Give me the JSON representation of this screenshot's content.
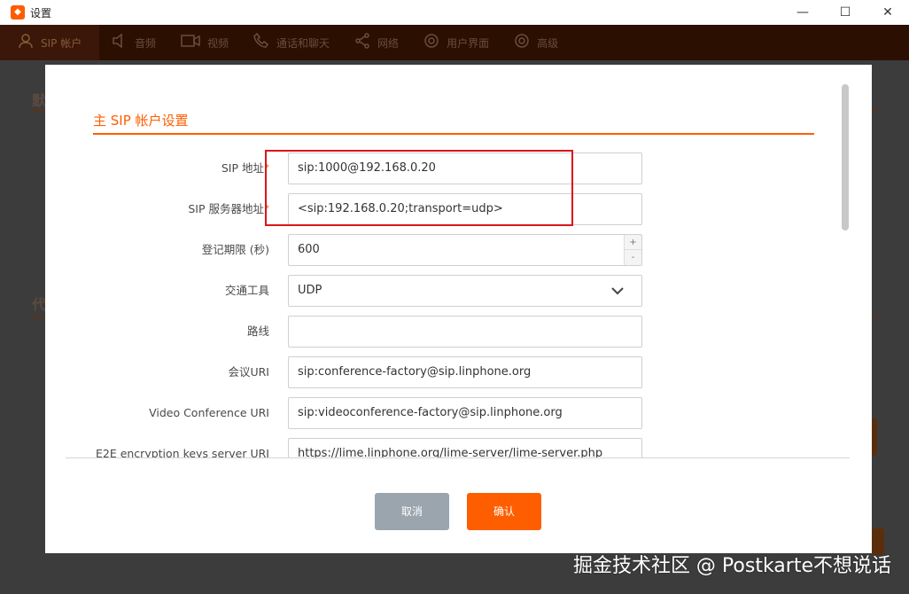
{
  "window": {
    "title": "设置",
    "logo": "linphone-logo-icon",
    "controls": {
      "minimize": "—",
      "maximize": "☐",
      "close": "✕"
    }
  },
  "tabs": [
    {
      "label": "SIP 帐户",
      "icon": "user-icon",
      "active": true
    },
    {
      "label": "音频",
      "icon": "speaker-icon",
      "active": false
    },
    {
      "label": "视频",
      "icon": "camera-icon",
      "active": false
    },
    {
      "label": "通话和聊天",
      "icon": "phone-icon",
      "active": false
    },
    {
      "label": "网络",
      "icon": "share-icon",
      "active": false
    },
    {
      "label": "用户界面",
      "icon": "gear-icon",
      "active": false
    },
    {
      "label": "高级",
      "icon": "gear-icon",
      "active": false
    }
  ],
  "background": {
    "section1": "默",
    "section2": "代"
  },
  "dialog": {
    "section_title": "主 SIP 帐户设置",
    "fields": [
      {
        "label": "SIP 地址",
        "required": "*",
        "value": "sip:1000@192.168.0.20"
      },
      {
        "label": "SIP 服务器地址",
        "required": "*",
        "value": "<sip:192.168.0.20;transport=udp>"
      },
      {
        "label": "登记期限 (秒)",
        "value": "600",
        "spin_up": "+",
        "spin_down": "-"
      },
      {
        "label": "交通工具",
        "value": "UDP"
      },
      {
        "label": "路线",
        "value": ""
      },
      {
        "label": "会议URI",
        "value": "sip:conference-factory@sip.linphone.org"
      },
      {
        "label": "Video Conference URI",
        "value": "sip:videoconference-factory@sip.linphone.org"
      },
      {
        "label": "E2E encryption keys server URI",
        "value": "https://lime.linphone.org/lime-server/lime-server.php"
      }
    ],
    "cancel_label": "取消",
    "ok_label": "确认"
  },
  "watermark": "掘金技术社区 @ Postkarte不想说话",
  "colors": {
    "accent": "#fe5e00",
    "highlight_box": "#d9161b",
    "cancel_button": "#9aa5ae"
  }
}
